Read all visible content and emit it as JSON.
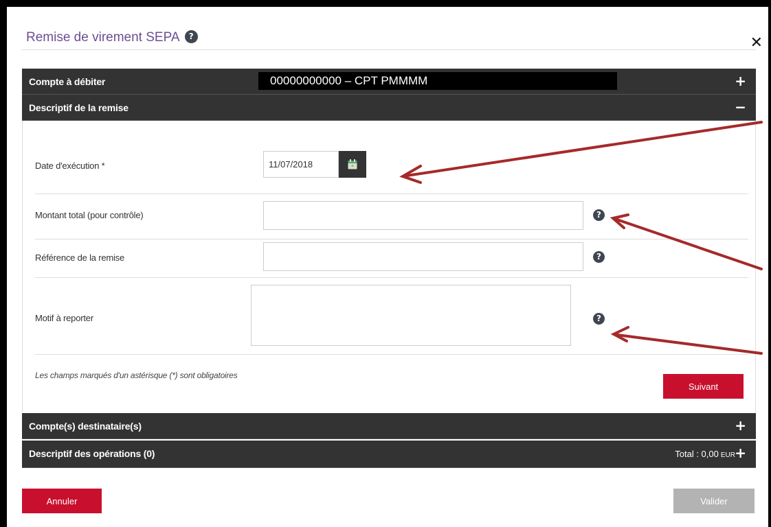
{
  "dialog": {
    "title": "Remise de virement SEPA",
    "close_symbol": "✕"
  },
  "panels": {
    "account": {
      "label": "Compte à débiter",
      "value": "00000000000 – CPT PMMMM",
      "toggle": "+"
    },
    "remise": {
      "label": "Descriptif de la remise",
      "toggle": "−"
    },
    "recipients": {
      "label": "Compte(s) destinataire(s)",
      "toggle": "+"
    },
    "operations": {
      "label": "Descriptif des opérations (0)",
      "total_label": "Total : 0,00",
      "currency": "EUR",
      "toggle": "+"
    }
  },
  "form": {
    "execution_date": {
      "label": "Date d'exécution *",
      "value": "11/07/2018"
    },
    "total_amount": {
      "label": "Montant total (pour contrôle)",
      "value": ""
    },
    "reference": {
      "label": "Référence de la remise",
      "value": ""
    },
    "motif": {
      "label": "Motif à reporter",
      "value": ""
    },
    "required_note": "Les champs marqués d'un astérisque (*) sont obligatoires",
    "next_label": "Suivant",
    "help_symbol": "?"
  },
  "footer": {
    "cancel_label": "Annuler",
    "validate_label": "Valider"
  },
  "colors": {
    "bar_bg": "#333333",
    "primary_red": "#c8102e",
    "title_purple": "#6b4e93",
    "disabled_gray": "#b3b3b3",
    "annotation_arrow": "#a52a2a"
  },
  "icons": {
    "calendar": "calendar-icon",
    "help": "question-circle-icon",
    "close": "close-icon"
  }
}
